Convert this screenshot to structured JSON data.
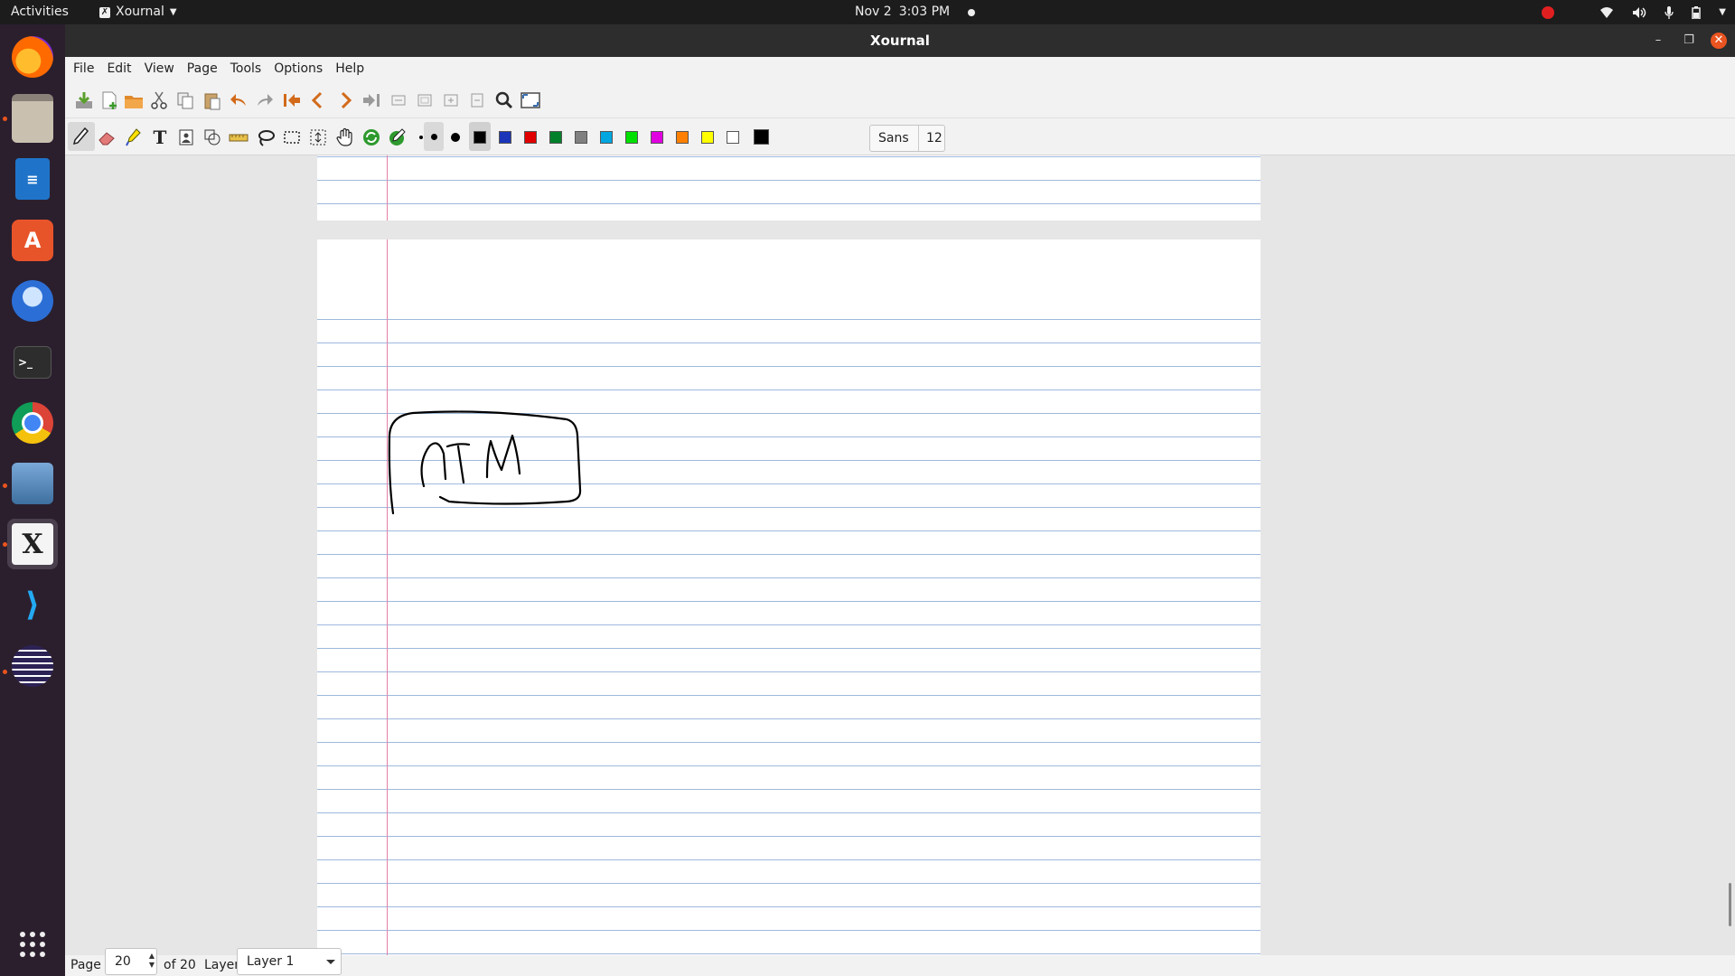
{
  "topbar": {
    "activities": "Activities",
    "app_name": "Xournal",
    "date": "Nov 2",
    "time": "3:03 PM"
  },
  "dock": {
    "apps": [
      "firefox-icon",
      "files-icon",
      "writer-icon",
      "software-center-icon",
      "thunderbird-icon",
      "terminal-icon",
      "chrome-icon",
      "screenshot-tool-icon",
      "xournal-icon",
      "vscode-icon",
      "eclipse-icon",
      "show-apps-icon"
    ]
  },
  "window": {
    "title": "Xournal",
    "menu": [
      "File",
      "Edit",
      "View",
      "Page",
      "Tools",
      "Options",
      "Help"
    ]
  },
  "toolbar": {
    "font_name": "Sans",
    "font_size": "12",
    "colors": [
      "#000000",
      "#1a35b8",
      "#e00000",
      "#00802a",
      "#808080",
      "#00a6e0",
      "#00e000",
      "#e000e0",
      "#ff8000",
      "#ffff00",
      "#ffffff",
      "#000000"
    ]
  },
  "canvas": {
    "handwriting": "ATM"
  },
  "status": {
    "page_label": "Page",
    "page_value": "20",
    "of_label": "of 20",
    "layer_label": "Layer:",
    "layer_value": "Layer 1"
  }
}
